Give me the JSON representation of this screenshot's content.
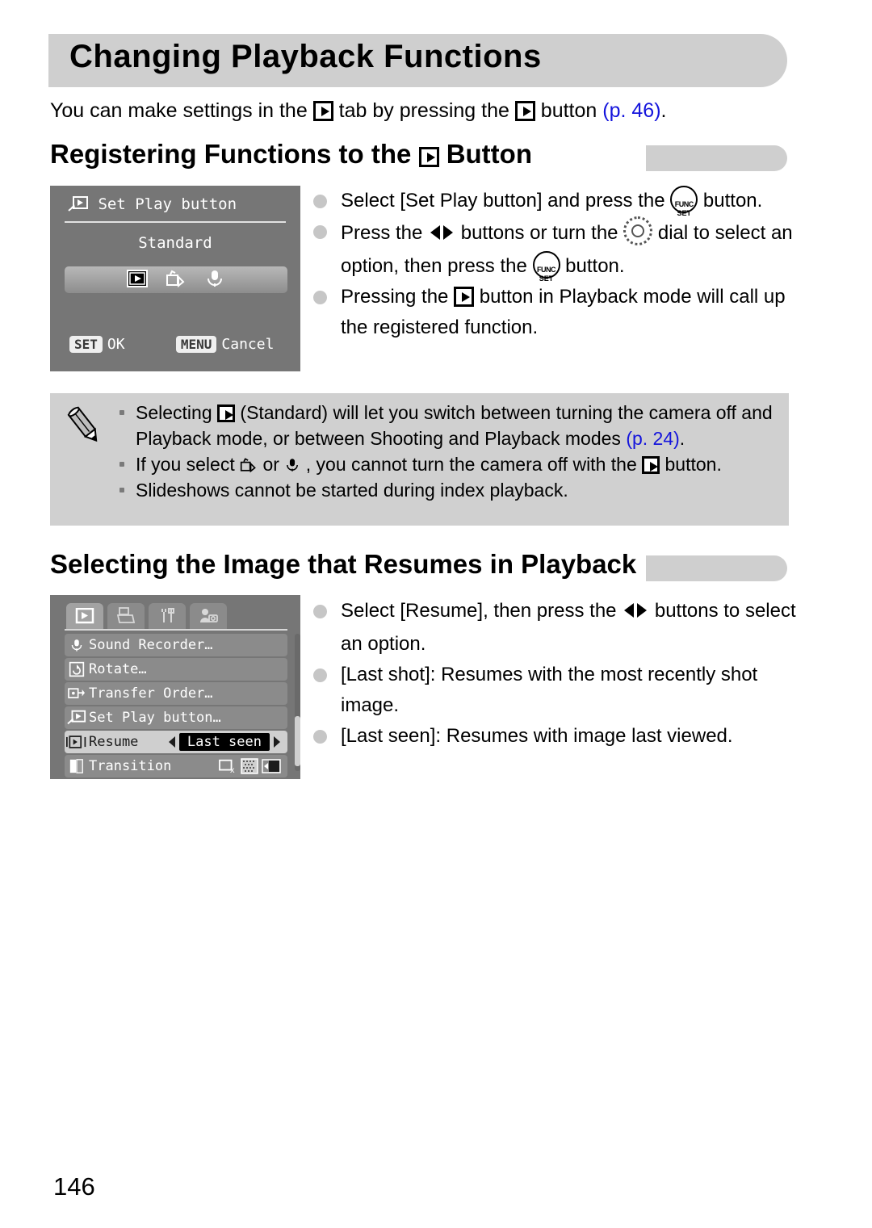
{
  "page": {
    "title": "Changing Playback Functions",
    "number": "146",
    "intro": {
      "part1": "You can make settings in the",
      "part2": "tab by pressing the",
      "part3": "button",
      "pageref": "(p. 46)",
      "period": "."
    }
  },
  "section1": {
    "heading_before": "Registering Functions to the",
    "heading_after": "Button",
    "lcd": {
      "header": "Set Play button",
      "value": "Standard",
      "options": [
        "playback-icon",
        "slideshow-icon",
        "microphone-icon"
      ],
      "selected_option": "playback-icon",
      "footer_set_key": "SET",
      "footer_set_label": "OK",
      "footer_menu_key": "MENU",
      "footer_menu_label": "Cancel"
    },
    "bullets": [
      {
        "text_before": "Select [Set Play button] and press the",
        "icon": "func-set-icon",
        "text_after": "button."
      },
      {
        "text_before": "Press the",
        "icon": "left-right-arrows-icon",
        "text_mid": "buttons or turn the",
        "icon2": "control-dial-icon",
        "text_mid2": "dial to select an option, then press the",
        "icon3": "func-set-icon",
        "text_after": "button."
      },
      {
        "text_before": "Pressing the",
        "icon": "playback-icon",
        "text_after": "button in Playback mode will call up the registered function."
      }
    ]
  },
  "note": {
    "icon": "pencil-icon",
    "items": [
      {
        "text_before": "Selecting",
        "icon": "playback-icon",
        "text_mid": "(Standard) will let you switch between turning the camera off and Playback mode, or between Shooting and Playback modes",
        "pageref": "(p. 24)",
        "text_after": "."
      },
      {
        "text_before": "If you select",
        "icon": "slideshow-icon",
        "text_mid": "or",
        "icon2": "microphone-icon",
        "text_mid2": ", you cannot turn the camera off with the",
        "icon3": "playback-icon",
        "text_after": "button."
      },
      {
        "text_before": "Slideshows cannot be started during index playback."
      }
    ]
  },
  "section2": {
    "heading": "Selecting the Image that Resumes in Playback",
    "lcd": {
      "tabs": [
        {
          "name": "playback-tab",
          "active": true
        },
        {
          "name": "print-tab",
          "active": false
        },
        {
          "name": "settings-tab",
          "active": false
        },
        {
          "name": "my-camera-tab",
          "active": false
        }
      ],
      "rows": [
        {
          "icon": "microphone-icon",
          "label": "Sound Recorder…",
          "selected": false
        },
        {
          "icon": "rotate-icon",
          "label": "Rotate…",
          "selected": false
        },
        {
          "icon": "transfer-order-icon",
          "label": "Transfer Order…",
          "selected": false
        },
        {
          "icon": "set-play-button-icon",
          "label": "Set Play button…",
          "selected": false
        },
        {
          "icon": "resume-icon",
          "label": "Resume",
          "value": "Last seen",
          "selected": true
        },
        {
          "icon": "transition-icon",
          "label": "Transition",
          "options": [
            "off-icon",
            "dissolve-icon",
            "scroll-icon"
          ],
          "selected": false
        }
      ]
    },
    "bullets": [
      {
        "text_before": "Select [Resume], then press the",
        "icon": "left-right-arrows-icon",
        "text_after": "buttons to select an option."
      },
      {
        "text_before": "[Last shot]: Resumes with the most recently shot image."
      },
      {
        "text_before": "[Last seen]: Resumes with image last viewed."
      }
    ]
  },
  "colors": {
    "bar_gray": "#cfcfcf",
    "note_bg": "#d0d0d0",
    "lcd_bg": "#767676",
    "link_blue": "#1414dc",
    "bullet_dot": "#c6c6c6"
  }
}
